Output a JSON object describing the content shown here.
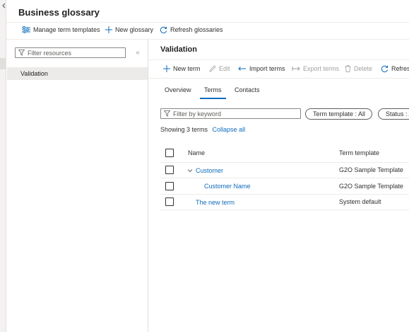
{
  "header": {
    "title": "Business glossary"
  },
  "toolbar": {
    "manage_templates": "Manage term templates",
    "new_glossary": "New glossary",
    "refresh": "Refresh glossaries"
  },
  "left_panel": {
    "filter_placeholder": "Filter resources",
    "collapse_glyph": "«",
    "items": [
      {
        "label": "Validation"
      }
    ]
  },
  "detail": {
    "title": "Validation",
    "toolbar": {
      "new_term": "New term",
      "edit": "Edit",
      "import_terms": "Import terms",
      "export_terms": "Export terms",
      "delete": "Delete",
      "refresh": "Refresh"
    },
    "tabs": [
      {
        "label": "Overview"
      },
      {
        "label": "Terms",
        "active": true
      },
      {
        "label": "Contacts"
      }
    ],
    "filter_placeholder": "Filter by keyword",
    "filters": {
      "term_template": "Term template : All",
      "status": "Status : All"
    },
    "showing_text": "Showing 3 terms",
    "collapse_all": "Collapse all",
    "table": {
      "columns": [
        "Name",
        "Term template"
      ],
      "rows": [
        {
          "name": "Customer",
          "template": "G2O Sample Template",
          "expanded": true,
          "indent": 0
        },
        {
          "name": "Customer Name",
          "template": "G2O Sample Template",
          "indent": 1
        },
        {
          "name": "The new term",
          "template": "System default",
          "indent": 0
        }
      ]
    }
  },
  "colors": {
    "accent": "#0f6cbd",
    "text": "#323130",
    "disabled": "#a19f9d",
    "selected_bg": "#edebe9"
  }
}
